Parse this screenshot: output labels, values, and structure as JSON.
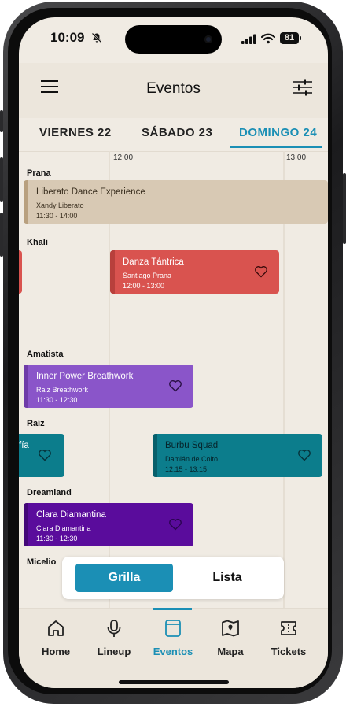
{
  "status_bar": {
    "time": "10:09",
    "battery": "81"
  },
  "header": {
    "title": "Eventos"
  },
  "day_tabs": [
    {
      "label": "VIERNES 22"
    },
    {
      "label": "SÁBADO 23"
    },
    {
      "label": "DOMINGO 24"
    }
  ],
  "timeline": {
    "ticks": [
      "12:00",
      "13:00"
    ]
  },
  "venues": {
    "prana": "Prana",
    "khali": "Khali",
    "amatista": "Amatista",
    "raiz": "Raíz",
    "dreamland": "Dreamland",
    "micelio": "Micelio"
  },
  "events": {
    "liberato": {
      "title": "Liberato Dance Experience",
      "artist": "Xandy Liberato",
      "time": "11:30 - 14:00"
    },
    "danza": {
      "title": "Danza Tántrica",
      "artist": "Santiago Prana",
      "time": "12:00 - 13:00"
    },
    "inner": {
      "title": "Inner Power Breathwork",
      "artist": "Raiz Breathwork",
      "time": "11:30 - 12:30"
    },
    "raiz_partial": {
      "title": "fía"
    },
    "burbu": {
      "title": "Burbu Squad",
      "artist": "Damián de Coito...",
      "time": "12:15 - 13:15"
    },
    "clara": {
      "title": "Clara Diamantina",
      "artist": "Clara Diamantina",
      "time": "11:30 - 12:30"
    }
  },
  "view_toggle": {
    "active": "Grilla",
    "inactive": "Lista"
  },
  "bottom_nav": [
    {
      "label": "Home",
      "icon": "home-icon"
    },
    {
      "label": "Lineup",
      "icon": "microphone-icon"
    },
    {
      "label": "Eventos",
      "icon": "calendar-icon"
    },
    {
      "label": "Mapa",
      "icon": "map-icon"
    },
    {
      "label": "Tickets",
      "icon": "ticket-icon"
    }
  ],
  "colors": {
    "accent": "#1b8fb5",
    "background": "#f0ebe3",
    "prana_card": "#d8c9b4",
    "khali_card": "#d9534f",
    "amatista_card": "#8a55c9",
    "raiz_card": "#0c7d8c",
    "dreamland_card": "#5a0c9c"
  }
}
